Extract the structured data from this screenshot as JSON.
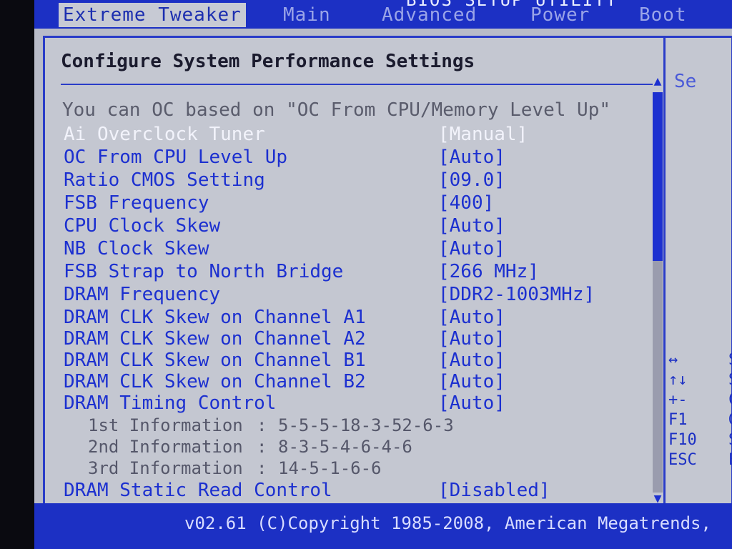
{
  "header": {
    "title": "BIOS SETUP UTILITY",
    "tabs": [
      {
        "label": "Extreme Tweaker",
        "active": true
      },
      {
        "label": "Main",
        "active": false
      },
      {
        "label": "Advanced",
        "active": false
      },
      {
        "label": "Power",
        "active": false
      },
      {
        "label": "Boot",
        "active": false
      }
    ]
  },
  "main": {
    "section_title": "Configure System Performance Settings",
    "info_note": "You can OC based on \"OC From CPU/Memory Level Up\"",
    "settings": [
      {
        "label": "Ai Overclock Tuner",
        "value": "[Manual]"
      },
      {
        "label": "OC From CPU Level Up",
        "value": "[Auto]"
      },
      {
        "label": "Ratio CMOS Setting",
        "value": "[09.0]"
      },
      {
        "label": "FSB Frequency",
        "value": "[400]"
      },
      {
        "label": "CPU Clock Skew",
        "value": "[Auto]"
      },
      {
        "label": "NB Clock Skew",
        "value": "[Auto]"
      },
      {
        "label": "FSB Strap to North Bridge",
        "value": "[266 MHz]"
      },
      {
        "label": "DRAM Frequency",
        "value": "[DDR2-1003MHz]"
      },
      {
        "label": "DRAM CLK Skew on Channel A1",
        "value": "[Auto]"
      },
      {
        "label": "DRAM CLK Skew on Channel A2",
        "value": "[Auto]"
      },
      {
        "label": "DRAM CLK Skew on Channel B1",
        "value": "[Auto]"
      },
      {
        "label": "DRAM CLK Skew on Channel B2",
        "value": "[Auto]"
      },
      {
        "label": "DRAM Timing Control",
        "value": "[Auto]"
      }
    ],
    "timing_info": [
      {
        "label": "1st Information",
        "value": "5-5-5-18-3-52-6-3"
      },
      {
        "label": "2nd Information",
        "value": "8-3-5-4-6-4-6"
      },
      {
        "label": "3rd Information",
        "value": "14-5-1-6-6"
      }
    ],
    "last_setting": {
      "label": "DRAM Static Read Control",
      "value": "[Disabled]"
    },
    "separator": ":"
  },
  "scroll": {
    "up": "▲",
    "down": "▼"
  },
  "help": {
    "title": "Se",
    "keys": [
      {
        "key": "↔",
        "desc": "S"
      },
      {
        "key": "↑↓",
        "desc": "S"
      },
      {
        "key": "+-",
        "desc": "C"
      },
      {
        "key": "F1",
        "desc": "Ge"
      },
      {
        "key": "F10",
        "desc": "Sa"
      },
      {
        "key": "ESC",
        "desc": "Ex"
      }
    ]
  },
  "footer": {
    "text": "v02.61 (C)Copyright 1985-2008, American Megatrends,"
  },
  "colors": {
    "bios_blue": "#1c30c4",
    "panel_gray": "#c4c7d1",
    "setting_blue": "#1c30d0",
    "highlight_text": "#f2f3fb"
  }
}
